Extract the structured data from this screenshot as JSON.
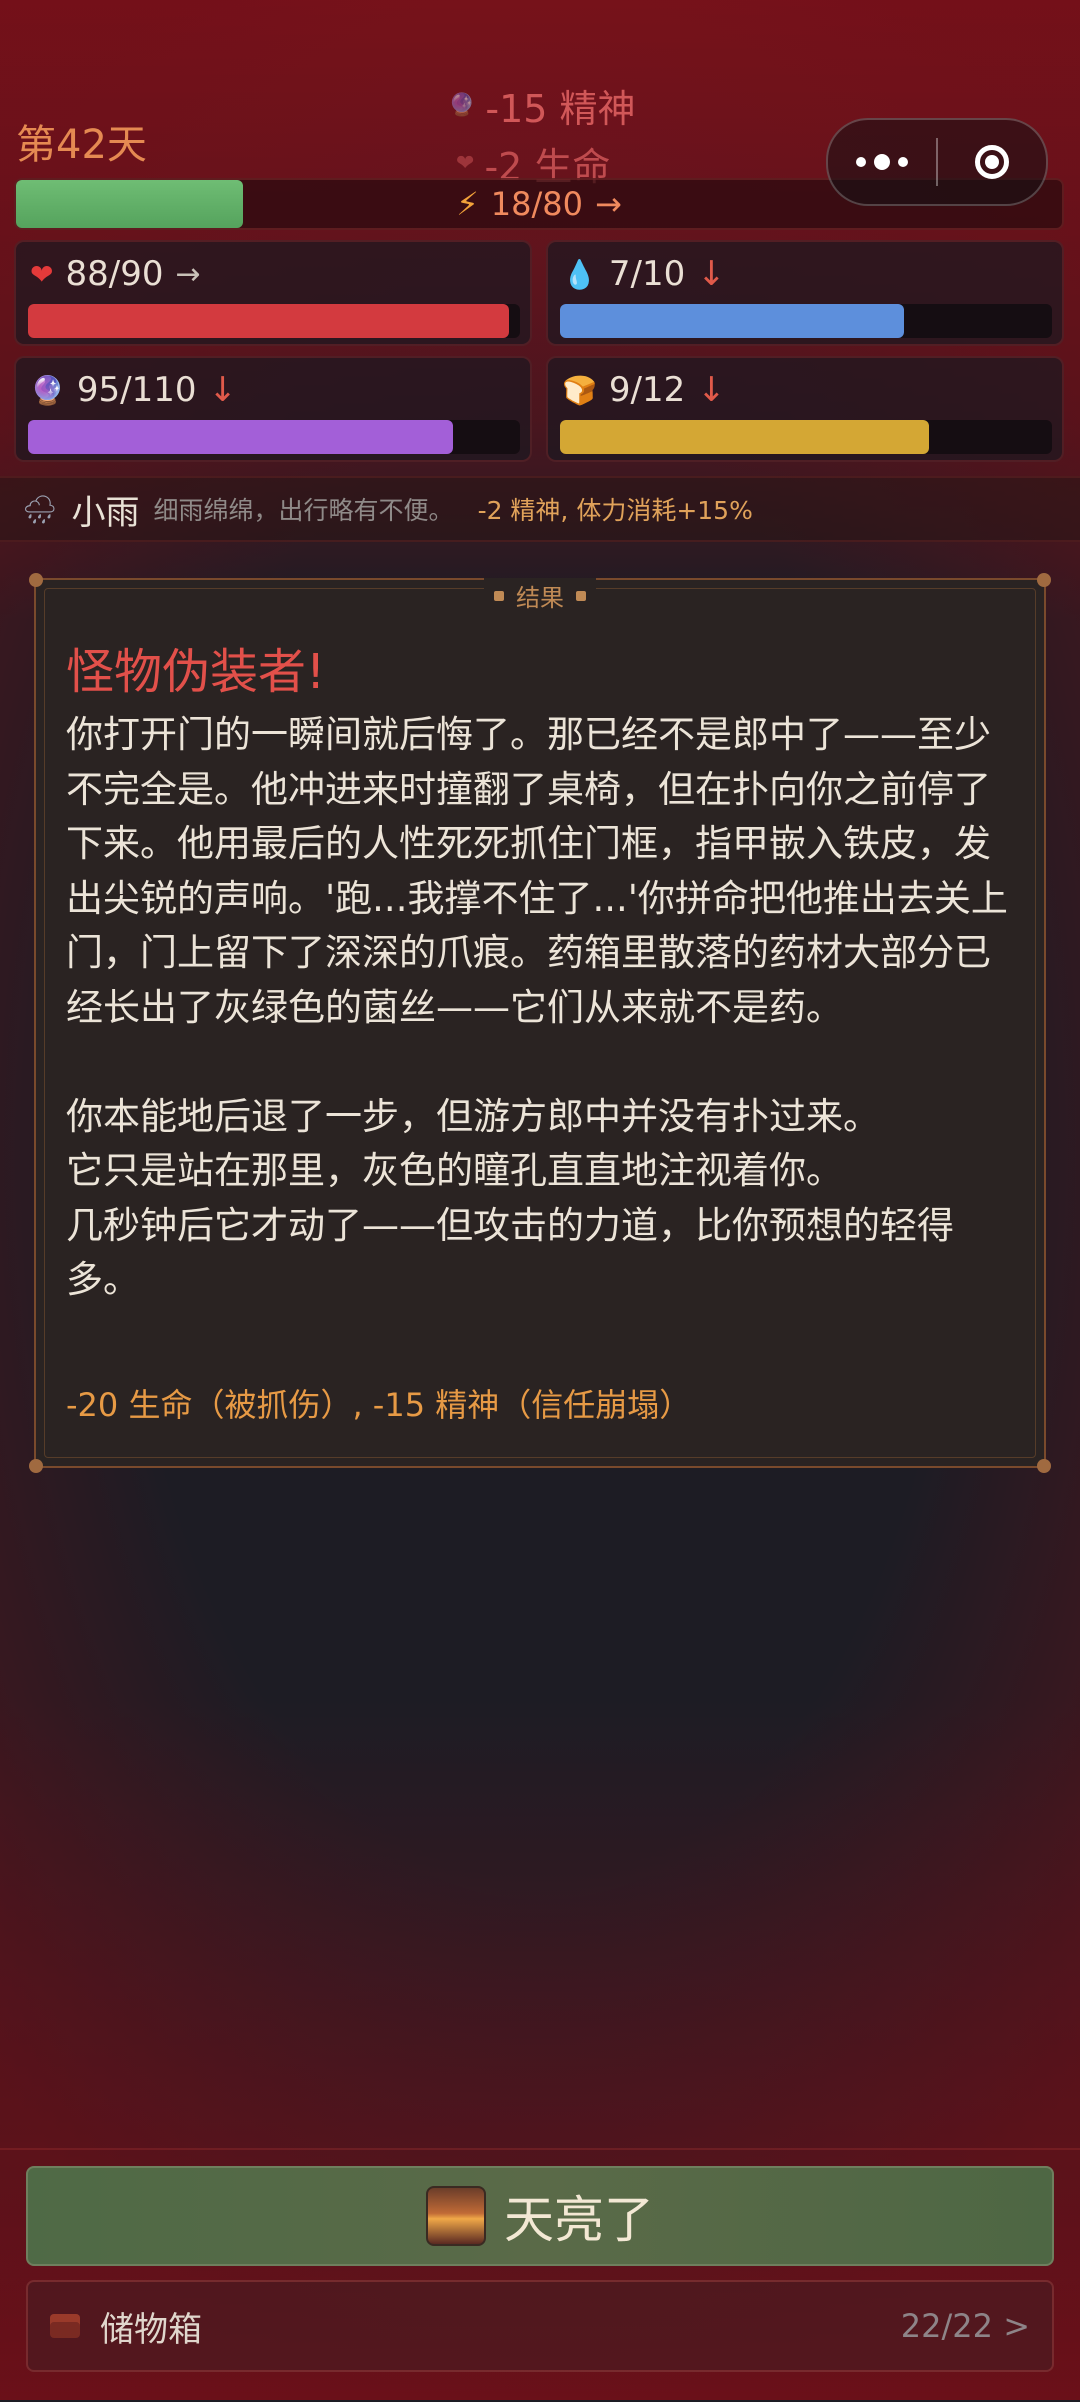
{
  "header": {
    "day": "第42天",
    "floating_effects": [
      "-15 精神",
      "-2 生命"
    ],
    "energy": {
      "label": "18/80",
      "trend": "→",
      "fraction": 0.2167
    }
  },
  "stats": [
    {
      "key": "health",
      "value": "88/90",
      "trend": "→",
      "fraction": 0.978,
      "color": "#d33a3f"
    },
    {
      "key": "water",
      "value": "7/10",
      "trend": "↓",
      "fraction": 0.7,
      "color": "#5d8fdc"
    },
    {
      "key": "spirit",
      "value": "95/110",
      "trend": "↓",
      "fraction": 0.864,
      "color": "#a35fd8"
    },
    {
      "key": "food",
      "value": "9/12",
      "trend": "↓",
      "fraction": 0.75,
      "color": "#d4a734"
    }
  ],
  "weather": {
    "name": "小雨",
    "description": "细雨绵绵，出行略有不便。",
    "effect": "-2 精神, 体力消耗+15%"
  },
  "result": {
    "panel_title": "结果",
    "heading": "怪物伪装者!",
    "paragraph1": "你打开门的一瞬间就后悔了。那已经不是郎中了——至少不完全是。他冲进来时撞翻了桌椅，但在扑向你之前停了下来。他用最后的人性死死抓住门框，指甲嵌入铁皮，发出尖锐的声响。'跑...我撑不住了...'你拼命把他推出去关上门，门上留下了深深的爪痕。药箱里散落的药材大部分已经长出了灰绿色的菌丝——它们从来就不是药。",
    "paragraph2": "你本能地后退了一步，但游方郎中并没有扑过来。\n它只是站在那里，灰色的瞳孔直直地注视着你。\n几秒钟后它才动了——但攻击的力道，比你预想的轻得多。",
    "consequence": "-20 生命（被抓伤）, -15 精神（信任崩塌）"
  },
  "actions": {
    "dawn_label": "天亮了",
    "storage_label": "储物箱",
    "storage_count": "22/22 >"
  },
  "icons": [
    "lightning-icon",
    "heart-icon",
    "water-drop-icon",
    "brain-icon",
    "bread-icon",
    "rain-cloud-icon",
    "sunrise-icon",
    "chest-icon",
    "more-icon",
    "close-target-icon"
  ]
}
